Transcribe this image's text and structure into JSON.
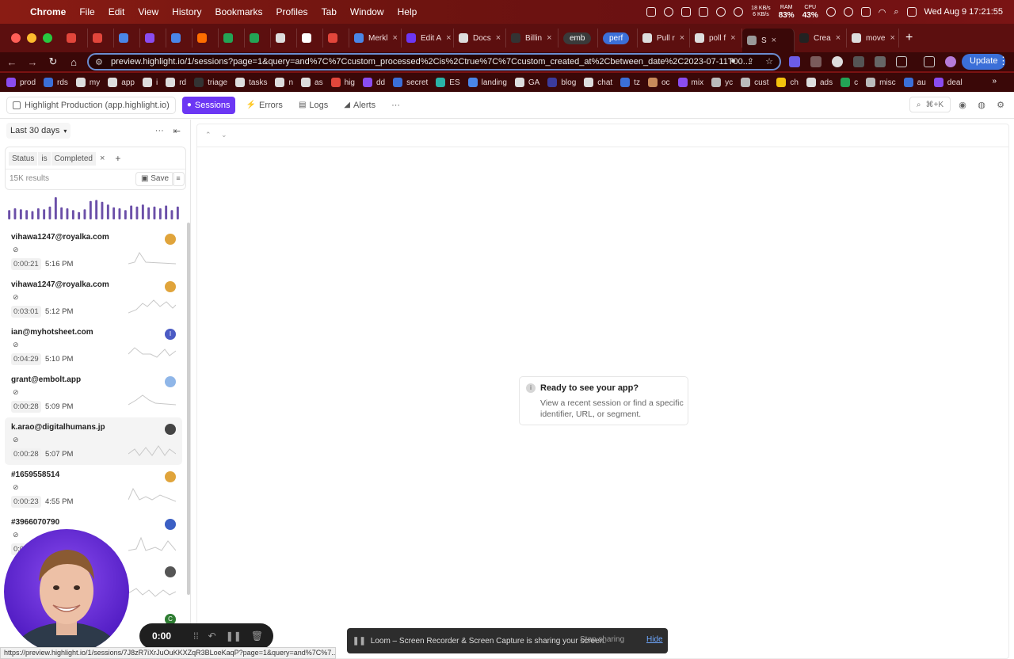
{
  "menubar": {
    "app": "Chrome",
    "items": [
      "File",
      "Edit",
      "View",
      "History",
      "Bookmarks",
      "Profiles",
      "Tab",
      "Window",
      "Help"
    ],
    "net": {
      "up": "18 KB/s",
      "down": "6 KB/s"
    },
    "ram": {
      "label": "RAM",
      "value": "83%"
    },
    "cpu": {
      "label": "CPU",
      "value": "43%"
    },
    "datetime": "Wed Aug 9  17:21:55"
  },
  "tabs": [
    {
      "label": "",
      "color": "#e2463b"
    },
    {
      "label": "",
      "color": "#e2463b"
    },
    {
      "label": "",
      "color": "#4a86e8"
    },
    {
      "label": "",
      "color": "#8a4cf0"
    },
    {
      "label": "",
      "color": "#4a86e8"
    },
    {
      "label": "",
      "color": "#ff6d00"
    },
    {
      "label": "",
      "color": "#23a455"
    },
    {
      "label": "",
      "color": "#23a455"
    },
    {
      "label": "",
      "color": "#dddddd"
    },
    {
      "label": "",
      "color": "#ffffff"
    },
    {
      "label": "",
      "color": "#e2463b"
    },
    {
      "label": "Merkl",
      "color": "#4a86e8"
    },
    {
      "label": "Edit A",
      "color": "#6c37f4"
    },
    {
      "label": "Docs",
      "color": "#dddddd"
    },
    {
      "label": "Billin",
      "color": "#333333"
    },
    {
      "label": "emb",
      "pill": true
    },
    {
      "label": "perf",
      "pill": true,
      "blue": true
    },
    {
      "label": "Pull r",
      "color": "#dddddd"
    },
    {
      "label": "poll f",
      "color": "#dddddd"
    },
    {
      "label": "S",
      "color": "#999999",
      "active": true
    },
    {
      "label": "Crea",
      "color": "#222222"
    },
    {
      "label": "move",
      "color": "#dddddd"
    }
  ],
  "newtab": "+",
  "omnibox": {
    "url": "preview.highlight.io/1/sessions?page=1&query=and%7C%7Ccustom_processed%2Cis%2Ctrue%7C%7Ccustom_created_at%2Cbetween_date%2C2023-07-11T00..."
  },
  "toolbar": {
    "update_label": "Update"
  },
  "bookmarks": [
    {
      "label": "prod",
      "color": "#8a4cf0"
    },
    {
      "label": "rds",
      "color": "#3b6fd8"
    },
    {
      "label": "my",
      "color": "#dddddd"
    },
    {
      "label": "app",
      "color": "#dddddd"
    },
    {
      "label": "i",
      "color": "#dddddd"
    },
    {
      "label": "rd",
      "color": "#dddddd"
    },
    {
      "label": "triage",
      "color": "#333333"
    },
    {
      "label": "tasks",
      "color": "#dddddd"
    },
    {
      "label": "n",
      "color": "#dddddd"
    },
    {
      "label": "as",
      "color": "#dddddd"
    },
    {
      "label": "hig",
      "color": "#e2463b"
    },
    {
      "label": "dd",
      "color": "#8a4cf0"
    },
    {
      "label": "secret",
      "color": "#3b6fd8"
    },
    {
      "label": "ES",
      "color": "#2ab3a6"
    },
    {
      "label": "landing",
      "color": "#4a86e8"
    },
    {
      "label": "GA",
      "color": "#dddddd"
    },
    {
      "label": "blog",
      "color": "#3b3b9c"
    },
    {
      "label": "chat",
      "color": "#dddddd"
    },
    {
      "label": "tz",
      "color": "#3b6fd8"
    },
    {
      "label": "oc",
      "color": "#c98a5a"
    },
    {
      "label": "mix",
      "color": "#8a4cf0"
    },
    {
      "label": "yc",
      "color": "#bbbbbb"
    },
    {
      "label": "cust",
      "color": "#bbbbbb"
    },
    {
      "label": "ch",
      "color": "#f4c20d"
    },
    {
      "label": "ads",
      "color": "#dddddd"
    },
    {
      "label": "c",
      "color": "#23a455"
    },
    {
      "label": "misc",
      "color": "#bbbbbb"
    },
    {
      "label": "au",
      "color": "#3b6fd8"
    },
    {
      "label": "deal",
      "color": "#8a4cf0"
    }
  ],
  "bookmarks_more": "»",
  "appbar": {
    "project": "Highlight Production (app.highlight.io)",
    "nav": [
      {
        "label": "Sessions",
        "icon": "●",
        "active": true
      },
      {
        "label": "Errors",
        "icon": "⚡"
      },
      {
        "label": "Logs",
        "icon": "▤"
      },
      {
        "label": "Alerts",
        "icon": "◢"
      },
      {
        "label": "···",
        "icon": ""
      }
    ],
    "search_shortcut": "⌘+K"
  },
  "sidebar": {
    "range": "Last 30 days",
    "filter": {
      "field": "Status",
      "op": "is",
      "value": "Completed"
    },
    "results": "15K results",
    "save_label": "Save",
    "histogram": [
      10,
      12,
      11,
      10,
      9,
      12,
      11,
      14,
      24,
      13,
      12,
      10,
      8,
      11,
      20,
      21,
      19,
      16,
      13,
      12,
      10,
      15,
      14,
      16,
      13,
      14,
      12,
      15,
      10,
      14
    ],
    "sessions": [
      {
        "id": "vihawa1247@royalka.com",
        "duration": "0:00:21",
        "time": "5:16 PM",
        "avatar_color": "#e0a43b",
        "avatar_text": ""
      },
      {
        "id": "vihawa1247@royalka.com",
        "duration": "0:03:01",
        "time": "5:12 PM",
        "avatar_color": "#e0a43b",
        "avatar_text": ""
      },
      {
        "id": "ian@myhotsheet.com",
        "duration": "0:04:29",
        "time": "5:10 PM",
        "avatar_color": "#4b5bc4",
        "avatar_text": "I"
      },
      {
        "id": "grant@embolt.app",
        "duration": "0:00:28",
        "time": "5:09 PM",
        "avatar_color": "#8fb6e8",
        "avatar_text": ""
      },
      {
        "id": "k.arao@digitalhumans.jp",
        "duration": "0:00:28",
        "time": "5:07 PM",
        "avatar_color": "#444444",
        "avatar_text": ""
      },
      {
        "id": "#1659558514",
        "duration": "0:00:23",
        "time": "4:55 PM",
        "avatar_color": "#e0a43b",
        "avatar_text": ""
      },
      {
        "id": "#3966070790",
        "duration": "0:0",
        "time": "",
        "avatar_color": "#3b5fc4",
        "avatar_text": ""
      },
      {
        "id": "",
        "duration": "",
        "time": "",
        "avatar_color": "#555555",
        "avatar_text": ""
      },
      {
        "id": "",
        "duration": "",
        "time": "",
        "avatar_color": "#2e7d32",
        "avatar_text": "C"
      }
    ]
  },
  "main": {
    "ready_title": "Ready to see your app?",
    "ready_desc": "View a recent session or find a specific identifier, URL, or segment.",
    "info_icon": "i"
  },
  "recorder": {
    "time": "0:00"
  },
  "statusbar": {
    "url": "https://preview.highlight.io/1/sessions/7J8zR7iXrJuOuKKXZqR3BLoeKaqP?page=1&query=and%7C%7..."
  },
  "loom": {
    "message": "Loom – Screen Recorder & Screen Capture is sharing your screen.",
    "stop_label": "Stop sharing",
    "hide_label": "Hide"
  }
}
